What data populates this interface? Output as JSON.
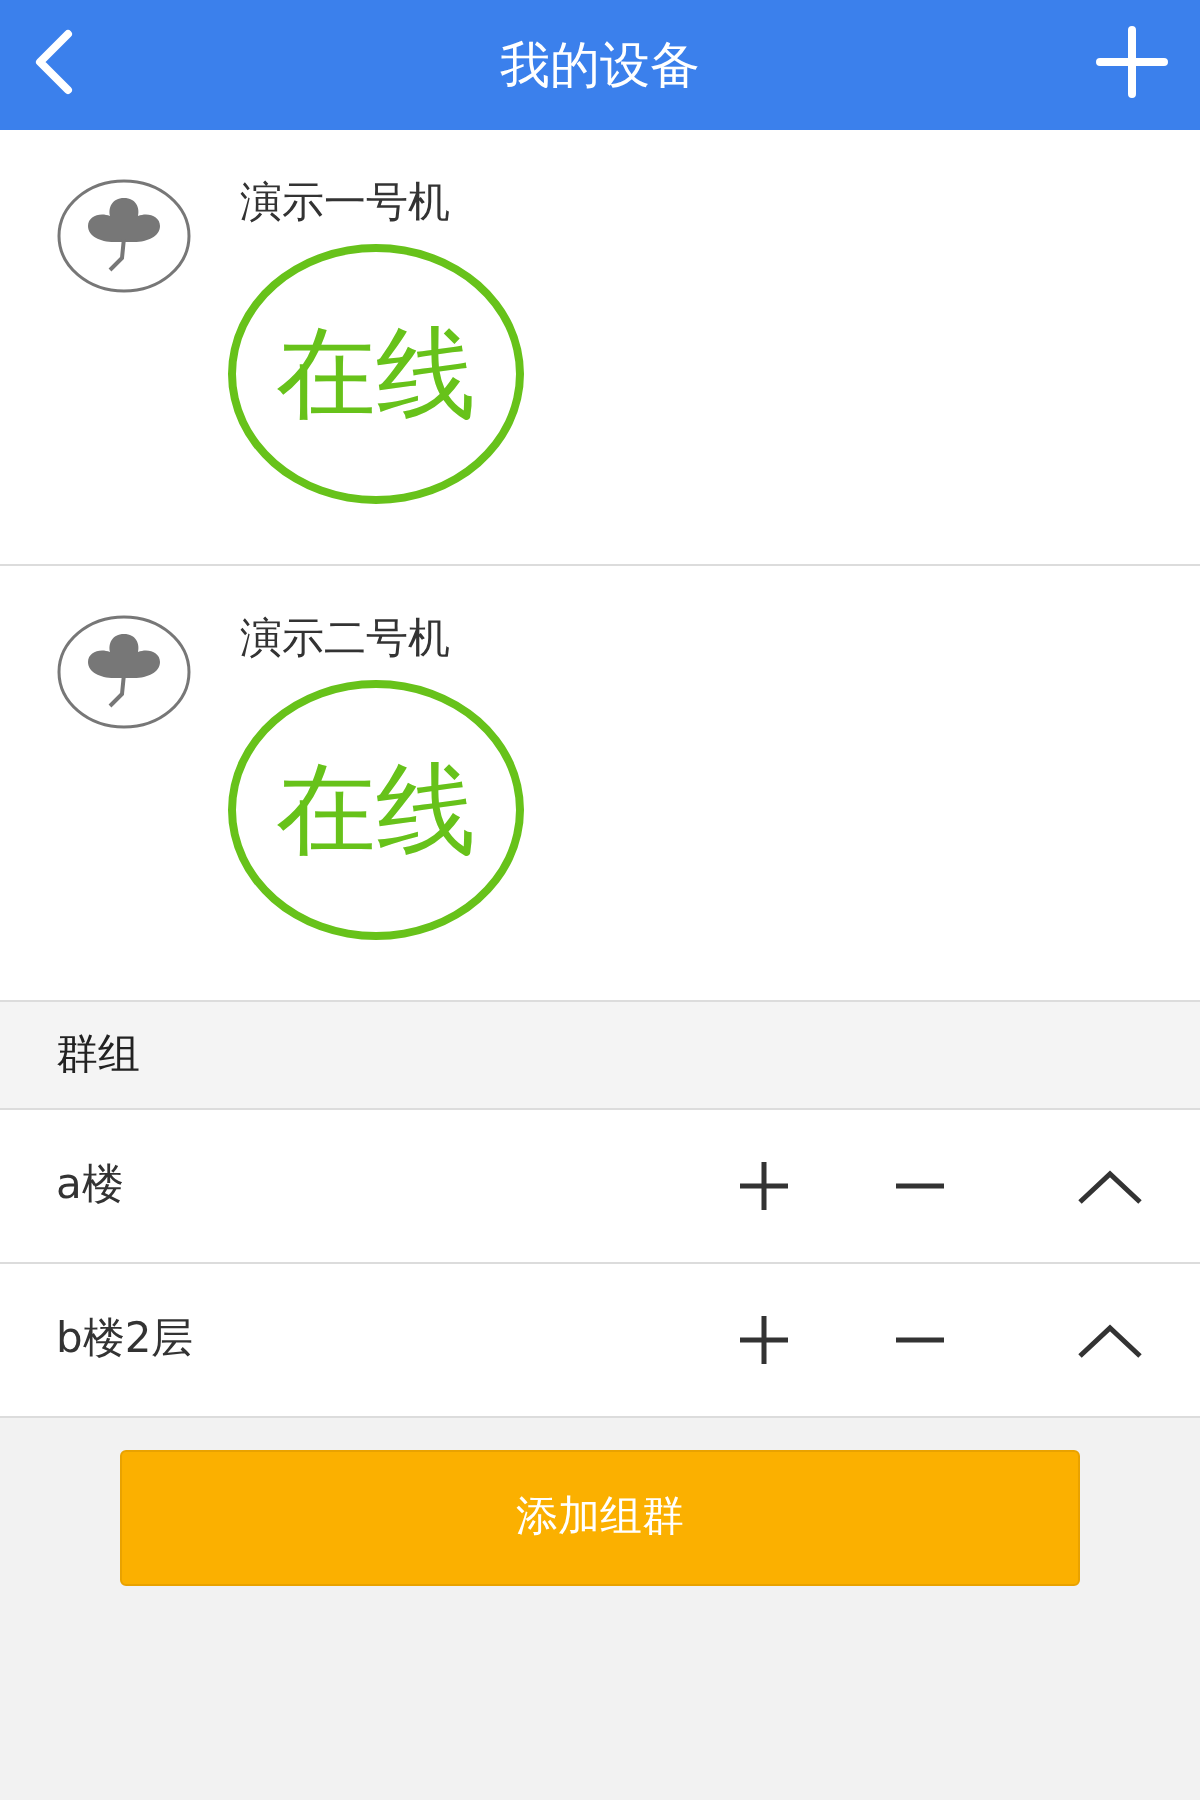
{
  "header": {
    "title": "我的设备"
  },
  "devices": [
    {
      "name": "演示一号机",
      "status": "在线"
    },
    {
      "name": "演示二号机",
      "status": "在线"
    }
  ],
  "groups_section": {
    "title": "群组",
    "groups": [
      {
        "name": "a楼"
      },
      {
        "name": "b楼2层"
      }
    ]
  },
  "add_group_button": "添加组群"
}
